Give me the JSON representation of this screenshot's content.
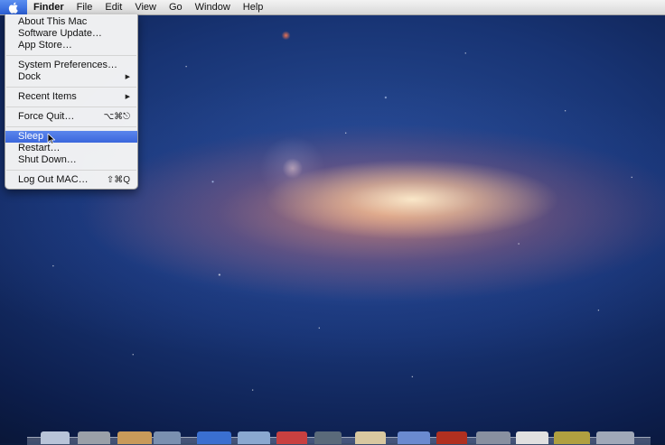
{
  "menubar": {
    "items": [
      "Finder",
      "File",
      "Edit",
      "View",
      "Go",
      "Window",
      "Help"
    ]
  },
  "apple_menu": {
    "groups": [
      [
        {
          "label": "About This Mac",
          "shortcut": "",
          "submenu": false
        },
        {
          "label": "Software Update…",
          "shortcut": "",
          "submenu": false
        },
        {
          "label": "App Store…",
          "shortcut": "",
          "submenu": false
        }
      ],
      [
        {
          "label": "System Preferences…",
          "shortcut": "",
          "submenu": false
        },
        {
          "label": "Dock",
          "shortcut": "",
          "submenu": true
        }
      ],
      [
        {
          "label": "Recent Items",
          "shortcut": "",
          "submenu": true
        }
      ],
      [
        {
          "label": "Force Quit…",
          "shortcut": "⌥⌘⎋",
          "submenu": false
        }
      ],
      [
        {
          "label": "Sleep",
          "shortcut": "",
          "submenu": false,
          "highlighted": true
        },
        {
          "label": "Restart…",
          "shortcut": "",
          "submenu": false
        },
        {
          "label": "Shut Down…",
          "shortcut": "",
          "submenu": false
        }
      ],
      [
        {
          "label": "Log Out MAC…",
          "shortcut": "⇧⌘Q",
          "submenu": false
        }
      ]
    ]
  },
  "dock": {
    "icons": [
      {
        "name": "dock-icon-1",
        "color": "#b8c4d8"
      },
      {
        "name": "dock-icon-2",
        "color": "#9aa0a8"
      },
      {
        "name": "dock-icon-3",
        "color": "#c89a5a"
      },
      {
        "name": "dock-icon-4",
        "color": "#7a90b0"
      },
      {
        "name": "dock-icon-5",
        "color": "#3a6fd0"
      },
      {
        "name": "dock-icon-6",
        "color": "#8aa8d0"
      },
      {
        "name": "dock-icon-7",
        "color": "#c84040"
      },
      {
        "name": "dock-icon-8",
        "color": "#5a6a7a"
      },
      {
        "name": "dock-icon-9",
        "color": "#d8c8a0"
      },
      {
        "name": "dock-icon-10",
        "color": "#6a8ad0"
      },
      {
        "name": "dock-icon-11",
        "color": "#b03020"
      },
      {
        "name": "dock-icon-12",
        "color": "#8890a0"
      },
      {
        "name": "dock-icon-13",
        "color": "#e0e0e0"
      },
      {
        "name": "dock-icon-14",
        "color": "#b0a040"
      },
      {
        "name": "dock-icon-15",
        "color": "#a0a8b8"
      }
    ]
  }
}
